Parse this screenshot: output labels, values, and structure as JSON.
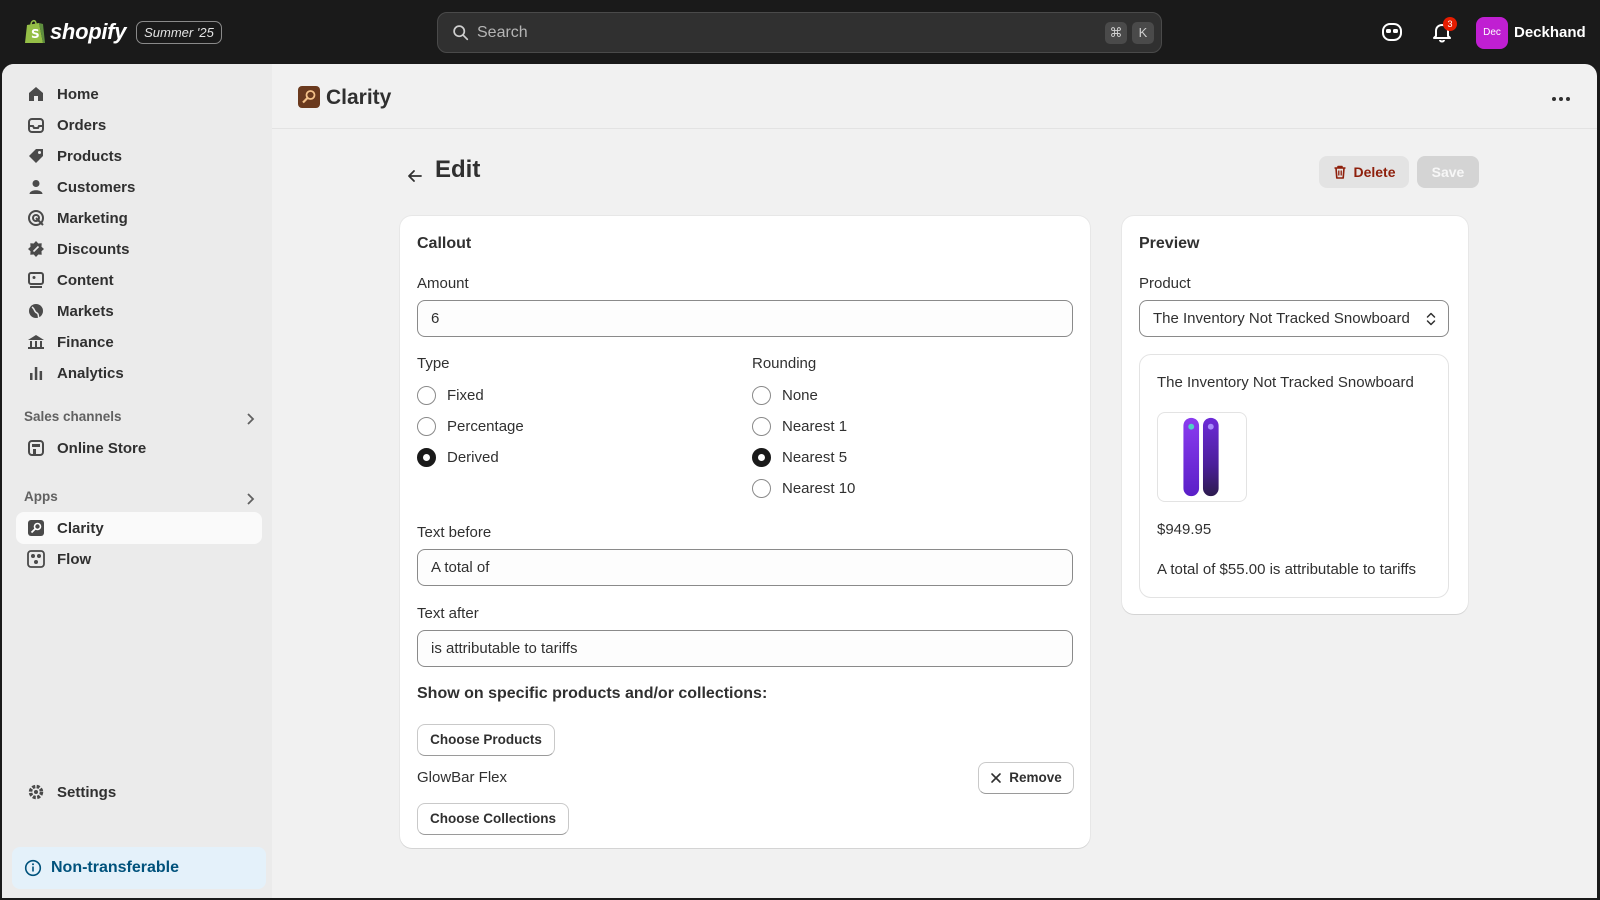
{
  "topbar": {
    "brand": "shopify",
    "edition": "Summer '25",
    "search_placeholder": "Search",
    "shortcut_cmd": "⌘",
    "shortcut_key": "K",
    "notification_count": "3",
    "avatar_initials": "Dec",
    "user_name": "Deckhand"
  },
  "sidebar": {
    "items": [
      {
        "label": "Home",
        "icon": "home-icon"
      },
      {
        "label": "Orders",
        "icon": "inbox-icon"
      },
      {
        "label": "Products",
        "icon": "tag-icon"
      },
      {
        "label": "Customers",
        "icon": "person-icon"
      },
      {
        "label": "Marketing",
        "icon": "target-icon"
      },
      {
        "label": "Discounts",
        "icon": "discount-icon"
      },
      {
        "label": "Content",
        "icon": "content-icon"
      },
      {
        "label": "Markets",
        "icon": "globe-icon"
      },
      {
        "label": "Finance",
        "icon": "bank-icon"
      },
      {
        "label": "Analytics",
        "icon": "bar-chart-icon"
      }
    ],
    "sales_channels_label": "Sales channels",
    "online_store_label": "Online Store",
    "apps_label": "Apps",
    "apps": [
      {
        "label": "Clarity",
        "icon": "search-key-icon",
        "active": true
      },
      {
        "label": "Flow",
        "icon": "flow-icon",
        "active": false
      }
    ],
    "settings_label": "Settings",
    "non_transferable_label": "Non-transferable"
  },
  "appbar": {
    "title": "Clarity"
  },
  "page": {
    "title": "Edit",
    "delete_label": "Delete",
    "save_label": "Save"
  },
  "callout": {
    "title": "Callout",
    "amount_label": "Amount",
    "amount_value": "6",
    "type_label": "Type",
    "type_options": [
      {
        "label": "Fixed",
        "selected": false
      },
      {
        "label": "Percentage",
        "selected": false
      },
      {
        "label": "Derived",
        "selected": true
      }
    ],
    "rounding_label": "Rounding",
    "rounding_options": [
      {
        "label": "None",
        "selected": false
      },
      {
        "label": "Nearest 1",
        "selected": false
      },
      {
        "label": "Nearest 5",
        "selected": true
      },
      {
        "label": "Nearest 10",
        "selected": false
      }
    ],
    "text_before_label": "Text before",
    "text_before_value": "A total of",
    "text_after_label": "Text after",
    "text_after_value": "is attributable to tariffs",
    "show_on_label": "Show on specific products and/or collections:",
    "choose_products_label": "Choose Products",
    "selected_product": "GlowBar Flex",
    "remove_label": "Remove",
    "choose_collections_label": "Choose Collections"
  },
  "preview": {
    "title": "Preview",
    "product_label": "Product",
    "product_selected": "The Inventory Not Tracked Snowboard",
    "product_name": "The Inventory Not Tracked Snowboard",
    "price": "$949.95",
    "callout_text": "A total of $55.00 is attributable to tariffs"
  },
  "colors": {
    "topbar_bg": "#1a1a1a",
    "avatar_bg": "#c01fd2",
    "delete_text": "#8e1f0b",
    "notice_bg": "#e4f1fa",
    "snowboard_purple": "#7b2fe0"
  }
}
